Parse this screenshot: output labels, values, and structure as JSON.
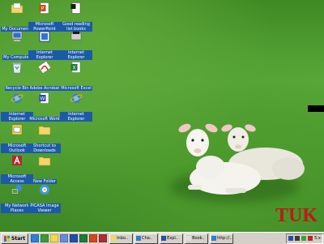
{
  "icons": [
    {
      "label": "My Documents",
      "icon": "folder-documents-icon"
    },
    {
      "label": "Microsoft PowerPoint",
      "icon": "powerpoint-icon"
    },
    {
      "label": "Good reading list books",
      "icon": "text-document-icon"
    },
    {
      "label": "My Computer",
      "icon": "computer-icon"
    },
    {
      "label": "Internet Explorer",
      "icon": "web-page-icon"
    },
    {
      "label": "Internet Explorer",
      "icon": "ie-shortcut-icon"
    },
    {
      "label": "Recycle Bin",
      "icon": "recycle-bin-icon"
    },
    {
      "label": "Adobe Acrobat",
      "icon": "acrobat-icon"
    },
    {
      "label": "Microsoft Excel",
      "icon": "excel-icon"
    },
    {
      "label": "Internet Explorer",
      "icon": "internet-explorer-icon"
    },
    {
      "label": "Microsoft Word",
      "icon": "word-icon"
    },
    {
      "label": "Internet Explorer",
      "icon": "internet-explorer-icon"
    },
    {
      "label": "Microsoft Outlook",
      "icon": "outlook-icon"
    },
    {
      "label": "Shortcut to Downloads",
      "icon": "folder-icon"
    },
    {
      "label": "Microsoft Access",
      "icon": "access-icon"
    },
    {
      "label": "New Folder",
      "icon": "folder-icon"
    },
    {
      "label": "My Network Places",
      "icon": "network-places-icon"
    },
    {
      "label": "PICASA Image Viewer",
      "icon": "picasa-icon"
    }
  ],
  "wallpaper_text": "TUK",
  "taskbar": {
    "start_label": "Start",
    "quick_launch": [
      "ie-icon",
      "desktop-icon",
      "outlook-icon",
      "mail-icon",
      "word-icon",
      "excel-icon",
      "powerpoint-icon",
      "access-icon"
    ],
    "tasks": [
      "Inbo..",
      "Cha..",
      "Expl..",
      "Book..",
      "http://.."
    ],
    "clock": "5:x"
  },
  "colors": {
    "label_bg": "#1c5aa8",
    "taskbar_bg": "#d4d0c8",
    "wallpaper_text": "#c01818"
  }
}
